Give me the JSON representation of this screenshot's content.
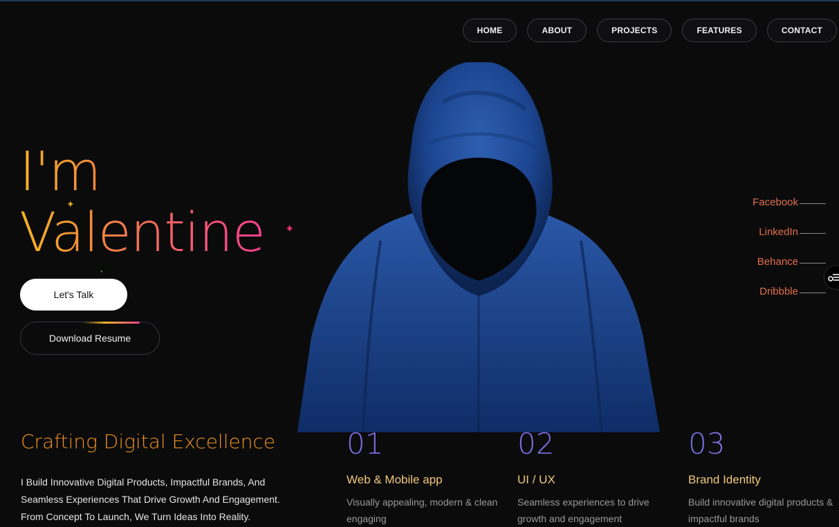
{
  "nav": {
    "items": [
      {
        "label": "HOME"
      },
      {
        "label": "ABOUT"
      },
      {
        "label": "PROJECTS"
      },
      {
        "label": "FEATURES"
      },
      {
        "label": "CONTACT"
      }
    ]
  },
  "hero": {
    "line1": "I'm",
    "line2": "Valentine",
    "talk_button": "Let's Talk",
    "resume_button": "Download Resume",
    "gradient_colors": [
      "#f5b324",
      "#f43f8e"
    ]
  },
  "social": {
    "items": [
      {
        "label": "Facebook"
      },
      {
        "label": "LinkedIn"
      },
      {
        "label": "Behance"
      },
      {
        "label": "Dribbble"
      }
    ],
    "color": "#e36f49"
  },
  "intro": {
    "title": "Crafting Digital Excellence",
    "description": "I Build Innovative Digital Products, Impactful Brands, And Seamless Experiences That Drive Growth And Engagement. From Concept To Launch, We Turn Ideas Into Reality."
  },
  "services": [
    {
      "number": "01",
      "title": "Web & Mobile app",
      "description": "Visually appealing, modern & clean engaging"
    },
    {
      "number": "02",
      "title": "UI / UX",
      "description": "Seamless experiences to drive growth and engagement"
    },
    {
      "number": "03",
      "title": "Brand Identity",
      "description": "Build innovative digital products & impactful brands"
    }
  ]
}
